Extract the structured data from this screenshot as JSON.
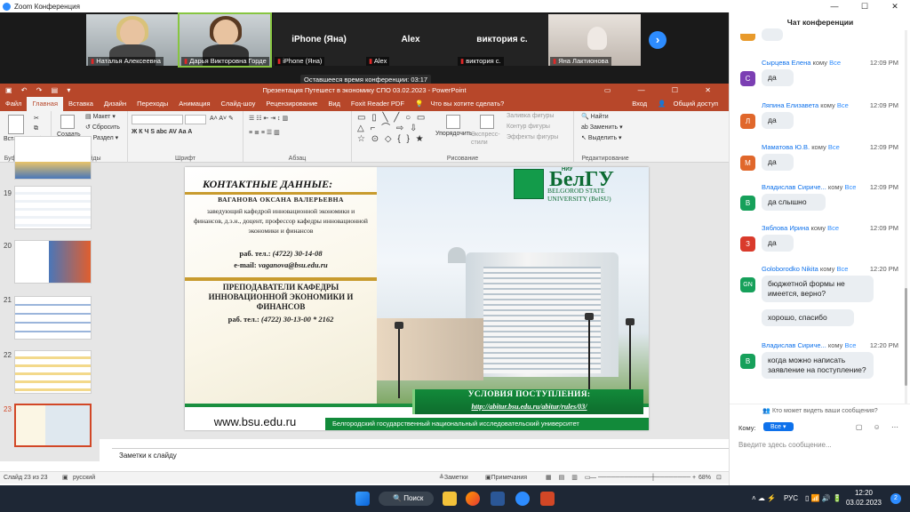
{
  "window": {
    "title": "Zoom Конференция"
  },
  "participants": [
    {
      "name": "Наталья Алексеевна",
      "video": true
    },
    {
      "name": "Дарья Викторовна Горде",
      "video": true,
      "active": true
    },
    {
      "name": "iPhone (Яна)",
      "label": "iPhone (Яна)"
    },
    {
      "name": "Alex",
      "label": "Alex"
    },
    {
      "name": "виктория с.",
      "label": "виктория с."
    },
    {
      "name": "Яна Лактионова",
      "video": true
    }
  ],
  "timer": "Оставшееся время конференции: 03:17",
  "powerpoint": {
    "title": "Презентация Путешест в экономику СПО 03.02.2023 - PowerPoint",
    "tabs": [
      "Файл",
      "Главная",
      "Вставка",
      "Дизайн",
      "Переходы",
      "Анимация",
      "Слайд-шоу",
      "Рецензирование",
      "Вид",
      "Foxit Reader PDF",
      "Что вы хотите сделать?"
    ],
    "tabs_right": [
      "Вход",
      "Общий доступ"
    ],
    "ribbon": {
      "paste": "Вставить",
      "buffer": "Буфер обмена",
      "create_slide": "Создать слайд",
      "layout": "Макет",
      "reset": "Сбросить",
      "section": "Раздел",
      "slides": "Слайды",
      "font": "Шрифт",
      "paragraph": "Абзац",
      "arrange": "Упорядочить",
      "quick_styles": "Экспресс-стили",
      "shape_fill": "Заливка фигуры",
      "shape_outline": "Контур фигуры",
      "shape_effects": "Эффекты фигуры",
      "drawing": "Рисование",
      "find": "Найти",
      "replace": "Заменить",
      "select": "Выделить",
      "editing": "Редактирование"
    },
    "slide_numbers": [
      "19",
      "20",
      "21",
      "22",
      "23"
    ],
    "notes_placeholder": "Заметки к слайду",
    "status": {
      "slide": "Слайд 23 из 23",
      "lang": "русский",
      "notes": "Заметки",
      "comments": "Примечания",
      "zoom": "68%"
    }
  },
  "slide": {
    "contacts_title": "КОНТАКТНЫЕ ДАННЫЕ:",
    "person": "ВАГАНОВА ОКСАНА ВАЛЕРЬЕВНА",
    "position": "заведующий кафедрой инновационной экономики и финансов, д.э.н., доцент, профессор кафедры инновационной экономики и финансов",
    "tel_label": "раб. тел.:",
    "tel": "(4722) 30-14-08",
    "email_label": "e-mail:",
    "email": "vaganova@bsu.edu.ru",
    "teachers": "ПРЕПОДАВАТЕЛИ КАФЕДРЫ ИННОВАЦИОННОЙ ЭКОНОМИКИ И ФИНАНСОВ",
    "tel2_label": "раб. тел.:",
    "tel2": "(4722) 30-13-00 * 2162",
    "logo_niu": "НИУ",
    "logo_text": "БелГУ",
    "logo_en1": "BELGOROD STATE",
    "logo_en2": "UNIVERSITY (BelSU)",
    "admission": "УСЛОВИЯ ПОСТУПЛЕНИЯ:",
    "admission_url": "http://abitur.bsu.edu.ru/abitur/rules/03/",
    "site": "www.bsu.edu.ru",
    "university": "Белгородский государственный национальный исследовательский университет"
  },
  "chat": {
    "title": "Чат конференции",
    "to_word": "кому",
    "all": "Все",
    "messages": [
      {
        "sender": "Сырцева Елена",
        "time": "12:09 PM",
        "initial": "С",
        "color": "#7b3fb3",
        "texts": [
          "да"
        ]
      },
      {
        "sender": "Ляпина Елизавета",
        "time": "12:09 PM",
        "initial": "Л",
        "color": "#e0672b",
        "texts": [
          "да"
        ]
      },
      {
        "sender": "Маматова Ю.В.",
        "time": "12:09 PM",
        "initial": "М",
        "color": "#e0672b",
        "texts": [
          "да"
        ]
      },
      {
        "sender": "Владислав Сириче...",
        "time": "12:09 PM",
        "initial": "В",
        "color": "#16a05a",
        "texts": [
          "да слышно"
        ]
      },
      {
        "sender": "Зяблова Ирина",
        "time": "12:09 PM",
        "initial": "З",
        "color": "#d93a2b",
        "texts": [
          "да"
        ]
      },
      {
        "sender": "Goloborodko Nikita",
        "time": "12:20 PM",
        "initial": "GN",
        "color": "#16a05a",
        "texts": [
          "бюджетной формы не имеется, верно?",
          "хорошо, спасибо"
        ]
      },
      {
        "sender": "Владислав Сириче...",
        "time": "12:20 PM",
        "initial": "В",
        "color": "#16a05a",
        "texts": [
          "когда можно написать заявление на поступление?"
        ]
      }
    ],
    "who_can_see": "Кто может видеть ваши сообщения?",
    "to_label": "Кому:",
    "to_value": "Все",
    "input_placeholder": "Введите здесь сообщение..."
  },
  "taskbar": {
    "search": "Поиск",
    "lang": "РУС",
    "time": "12:20",
    "date": "03.02.2023",
    "badge": "2"
  }
}
